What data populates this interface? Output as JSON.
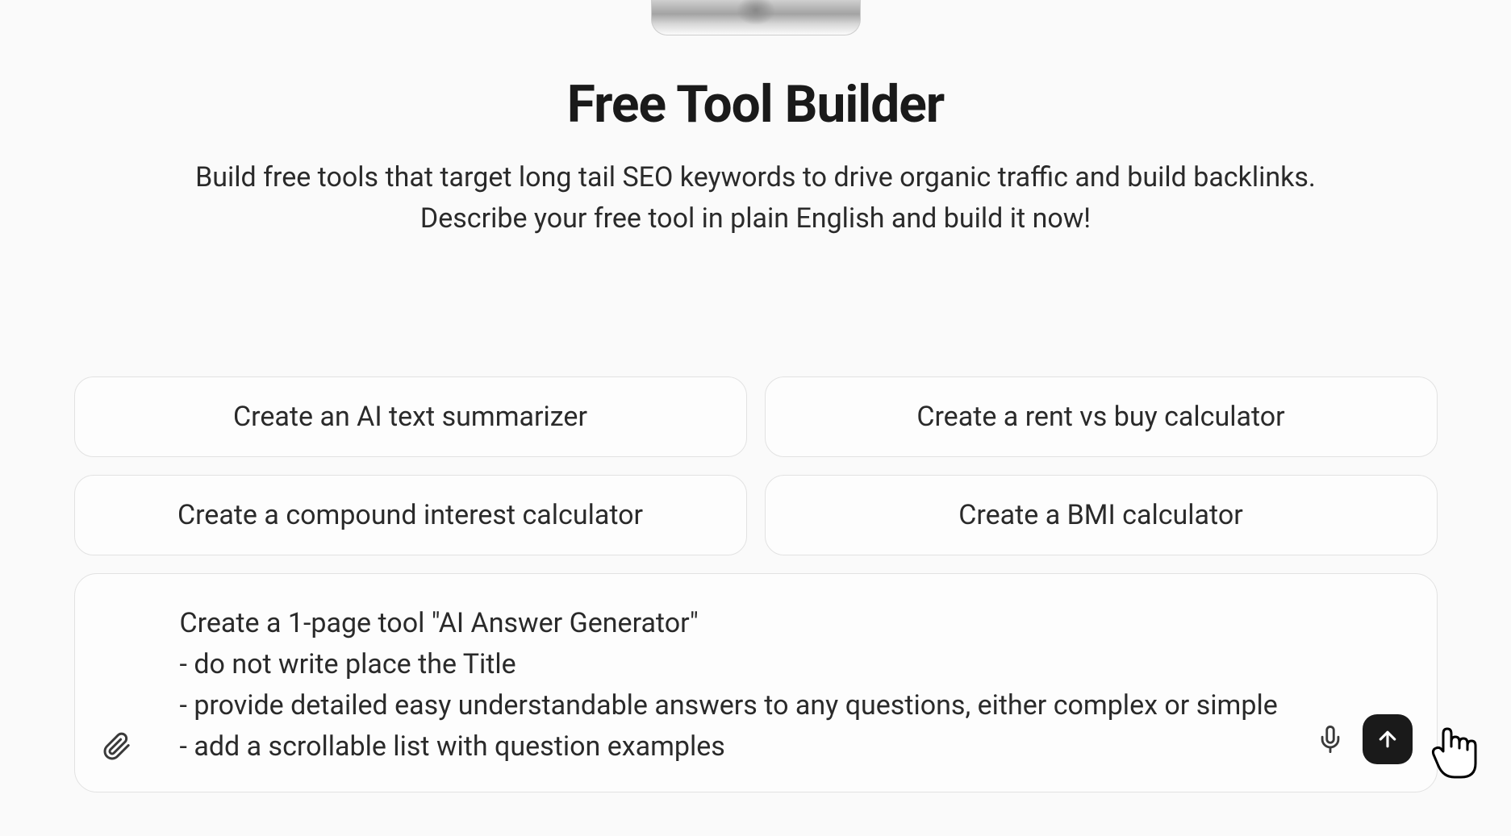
{
  "header": {
    "title": "Free Tool Builder",
    "subtitle": "Build free tools that target long tail SEO keywords to drive organic traffic and build backlinks. Describe your free tool in plain English and build it now!"
  },
  "suggestions": [
    {
      "label": "Create an AI text summarizer"
    },
    {
      "label": "Create a rent vs buy calculator"
    },
    {
      "label": "Create a compound interest calculator"
    },
    {
      "label": "Create a BMI calculator"
    }
  ],
  "input": {
    "value": "Create a 1-page tool \"AI Answer Generator\"\n- do not write place the Title\n- provide detailed easy understandable answers to any questions, either complex or simple\n- add a scrollable list with question examples"
  },
  "icons": {
    "attach": "paperclip-icon",
    "mic": "microphone-icon",
    "send": "arrow-up-icon"
  }
}
